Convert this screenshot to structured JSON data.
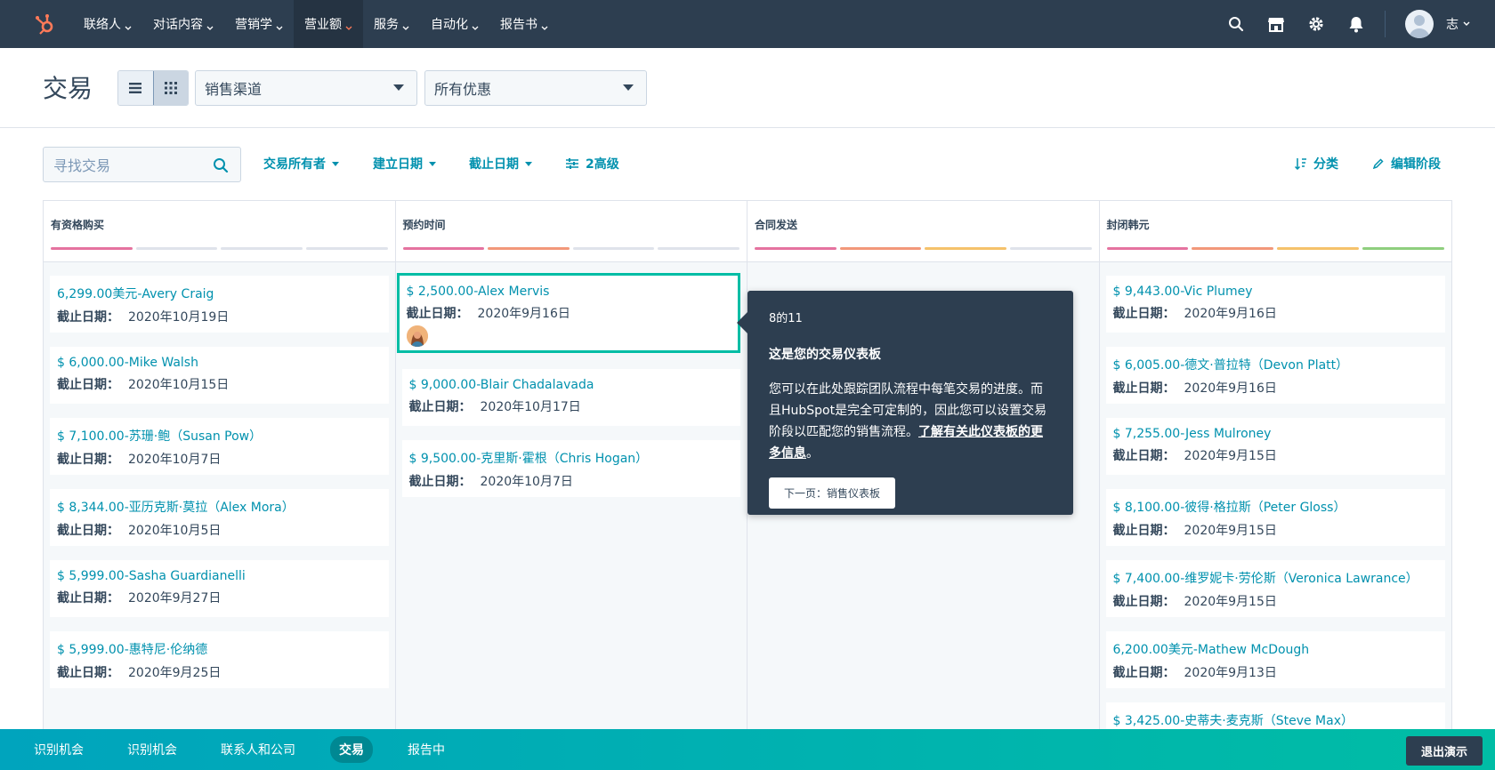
{
  "topnav": {
    "items": [
      {
        "label": "联络人"
      },
      {
        "label": "对话内容"
      },
      {
        "label": "营销学"
      },
      {
        "label": "营业额"
      },
      {
        "label": "服务"
      },
      {
        "label": "自动化"
      },
      {
        "label": "报告书"
      }
    ],
    "active_index": 3,
    "user_name": "志"
  },
  "header": {
    "title": "交易",
    "pipeline_select": "销售渠道",
    "deals_select": "所有优惠"
  },
  "filters": {
    "search_placeholder": "寻找交易",
    "owner": "交易所有者",
    "create_date": "建立日期",
    "close_date": "截止日期",
    "advanced": "2高级",
    "sort": "分类",
    "edit_stages": "编辑阶段"
  },
  "board": {
    "close_date_label": "截止日期：",
    "columns": [
      {
        "title": "有资格购买",
        "progress": [
          "#e5739f",
          "#dfe3eb",
          "#dfe3eb",
          "#dfe3eb"
        ],
        "cards": [
          {
            "title": "6,299.00美元-Avery Craig",
            "date": "2020年10月19日"
          },
          {
            "title": "$ 6,000.00-Mike Walsh",
            "date": "2020年10月15日"
          },
          {
            "title": "$ 7,100.00-苏珊·鲍（Susan Pow）",
            "date": "2020年10月7日"
          },
          {
            "title": "$ 8,344.00-亚历克斯·莫拉（Alex Mora）",
            "date": "2020年10月5日"
          },
          {
            "title": "$ 5,999.00-Sasha Guardianelli",
            "date": "2020年9月27日"
          },
          {
            "title": "$ 5,999.00-惠特尼·伦纳德",
            "date": "2020年9月25日"
          }
        ]
      },
      {
        "title": "预约时间",
        "progress": [
          "#e5739f",
          "#f2987a",
          "#dfe3eb",
          "#dfe3eb"
        ],
        "cards": [
          {
            "title": "$ 2,500.00-Alex Mervis",
            "date": "2020年9月16日"
          },
          {
            "title": "$ 9,000.00-Blair Chadalavada",
            "date": "2020年10月17日"
          },
          {
            "title": "$ 9,500.00-克里斯·霍根（Chris Hogan）",
            "date": "2020年10月7日"
          }
        ]
      },
      {
        "title": "合同发送",
        "progress": [
          "#e5739f",
          "#f2987a",
          "#f5c26b",
          "#dfe3eb"
        ],
        "cards": []
      },
      {
        "title": "封闭韩元",
        "progress": [
          "#e5739f",
          "#f2987a",
          "#f5c26b",
          "#8fcf7e"
        ],
        "cards": [
          {
            "title": "$ 9,443.00-Vic Plumey",
            "date": "2020年9月16日"
          },
          {
            "title": "$ 6,005.00-德文·普拉特（Devon Platt）",
            "date": "2020年9月16日"
          },
          {
            "title": "$ 7,255.00-Jess Mulroney",
            "date": "2020年9月15日"
          },
          {
            "title": "$ 8,100.00-彼得·格拉斯（Peter Gloss）",
            "date": "2020年9月15日"
          },
          {
            "title": "$ 7,400.00-维罗妮卡·劳伦斯（Veronica Lawrance）",
            "date": "2020年9月15日"
          },
          {
            "title": "6,200.00美元-Mathew McDough",
            "date": "2020年9月13日"
          },
          {
            "title": "$ 3,425.00-史蒂夫·麦克斯（Steve Max）",
            "date": ""
          }
        ]
      }
    ]
  },
  "tooltip": {
    "step": "8的11",
    "title": "这是您的交易仪表板",
    "body": "您可以在此处跟踪团队流程中每笔交易的进度。而且HubSpot是完全可定制的，因此您可以设置交易阶段以匹配您的销售流程。",
    "link": "了解有关此仪表板的更多信息",
    "link_suffix": "。",
    "button": "下一页：销售仪表板"
  },
  "bottombar": {
    "items": [
      "识别机会",
      "识别机会",
      "联系人和公司",
      "交易",
      "报告中"
    ],
    "active_index": 3,
    "exit": "退出演示"
  },
  "colors": {
    "nav_bg": "#2d3e50",
    "link": "#0091ae",
    "highlight": "#00bda5",
    "brand_orange": "#ff7a59"
  }
}
